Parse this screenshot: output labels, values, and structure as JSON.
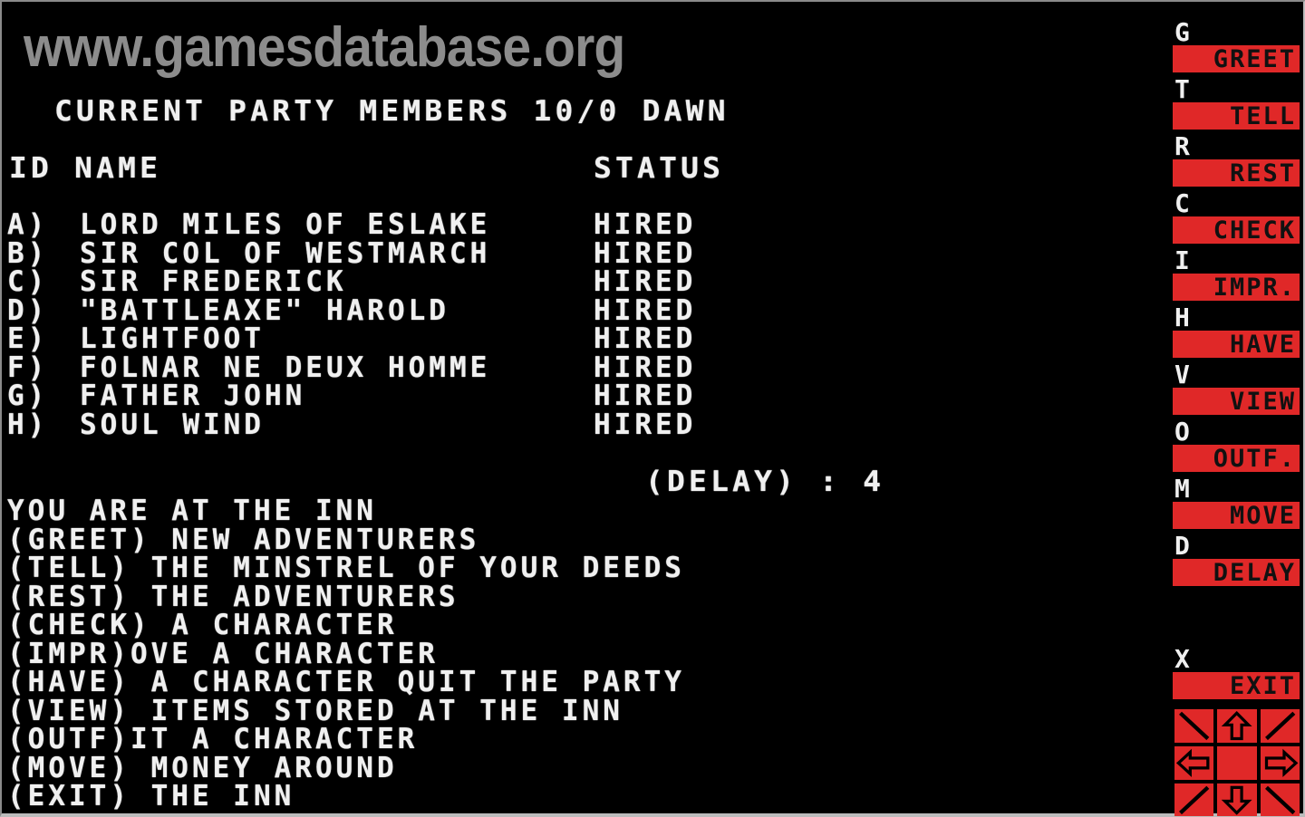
{
  "watermark": "www.gamesdatabase.org",
  "screen": {
    "title": "CURRENT PARTY MEMBERS 10/0 DAWN",
    "columns": {
      "id_name": "ID NAME",
      "status": "STATUS"
    },
    "party": [
      {
        "id": "A)",
        "name": "LORD MILES OF ESLAKE",
        "status": "HIRED"
      },
      {
        "id": "B)",
        "name": "SIR COL OF WESTMARCH",
        "status": "HIRED"
      },
      {
        "id": "C)",
        "name": "SIR FREDERICK",
        "status": "HIRED"
      },
      {
        "id": "D)",
        "name": "\"BATTLEAXE\" HAROLD",
        "status": "HIRED"
      },
      {
        "id": "E)",
        "name": "LIGHTFOOT",
        "status": "HIRED"
      },
      {
        "id": "F)",
        "name": "FOLNAR NE DEUX HOMME",
        "status": "HIRED"
      },
      {
        "id": "G)",
        "name": "FATHER JOHN",
        "status": "HIRED"
      },
      {
        "id": "H)",
        "name": "SOUL WIND",
        "status": "HIRED"
      }
    ],
    "delay": "(DELAY) : 4",
    "menu": [
      "YOU ARE AT THE INN",
      "(GREET) NEW ADVENTURERS",
      "(TELL) THE MINSTREL OF YOUR DEEDS",
      "(REST) THE ADVENTURERS",
      "(CHECK) A CHARACTER",
      "(IMPR)OVE A CHARACTER",
      "(HAVE) A CHARACTER QUIT THE PARTY",
      "(VIEW) ITEMS STORED AT THE INN",
      "(OUTF)IT A CHARACTER",
      "(MOVE) MONEY AROUND",
      "(EXIT) THE INN"
    ]
  },
  "sidebar": {
    "commands": [
      {
        "key": "G",
        "label": "GREET"
      },
      {
        "key": "T",
        "label": "TELL"
      },
      {
        "key": "R",
        "label": "REST"
      },
      {
        "key": "C",
        "label": "CHECK"
      },
      {
        "key": "I",
        "label": "IMPR."
      },
      {
        "key": "H",
        "label": "HAVE"
      },
      {
        "key": "V",
        "label": "VIEW"
      },
      {
        "key": "O",
        "label": "OUTF."
      },
      {
        "key": "M",
        "label": "MOVE"
      },
      {
        "key": "D",
        "label": "DELAY"
      }
    ],
    "exit": {
      "key": "X",
      "label": "EXIT"
    },
    "dpad_icons": [
      "arrow-up-left-icon",
      "arrow-up-icon",
      "arrow-up-right-icon",
      "arrow-left-icon",
      "center-icon",
      "arrow-right-icon",
      "arrow-down-left-icon",
      "arrow-down-icon",
      "arrow-down-right-icon"
    ]
  },
  "colors": {
    "background": "#000000",
    "text": "#f0f0f0",
    "button": "#e02828",
    "watermark": "#8c8c8c"
  }
}
